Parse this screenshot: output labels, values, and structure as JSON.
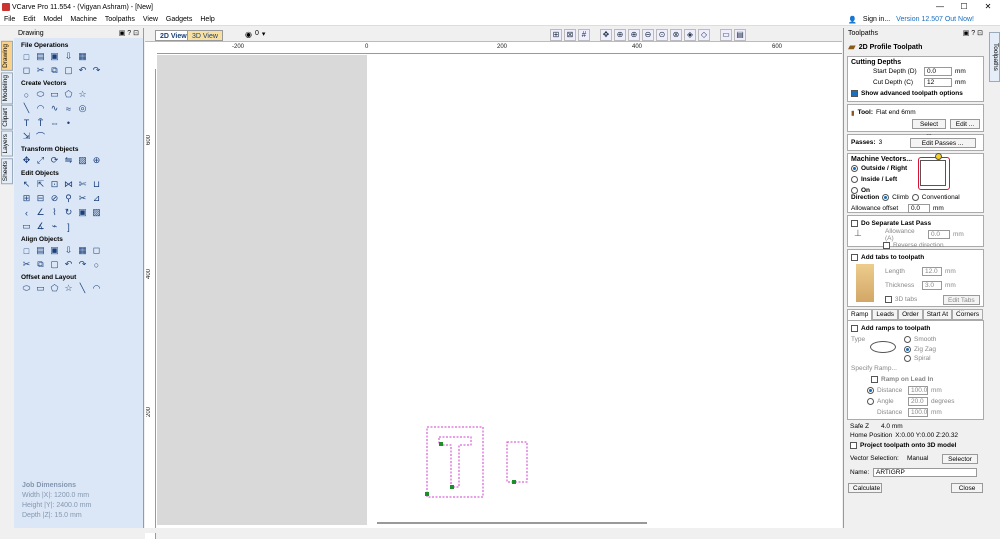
{
  "window": {
    "title": "VCarve Pro 11.554 - (Vigyan Ashram) - [New]",
    "min": "—",
    "max": "☐",
    "close": "✕"
  },
  "menu": {
    "items": [
      "File",
      "Edit",
      "Model",
      "Machine",
      "Toolpaths",
      "View",
      "Gadgets",
      "Help"
    ],
    "signin": "Sign in...",
    "version": "Version 12.507 Out Now!"
  },
  "left_panel": {
    "title": "Drawing",
    "side_tabs": [
      "Drawing",
      "Modeling",
      "Clipart",
      "Layers",
      "Sheets"
    ],
    "sections": [
      {
        "title": "File Operations",
        "rows": [
          [
            "new-file-icon",
            "open-file-icon",
            "save-icon",
            "import-icon",
            "folder-icon"
          ],
          [
            "select-all-icon",
            "cut-icon",
            "copy-icon",
            "paste-icon",
            "undo-icon",
            "redo-icon"
          ]
        ]
      },
      {
        "title": "Create Vectors",
        "rows": [
          [
            "circle-icon",
            "ellipse-icon",
            "rectangle-icon",
            "polygon-icon",
            "star-icon"
          ],
          [
            "line-icon",
            "arc-icon",
            "curve-icon",
            "wave-icon",
            "spiral-icon"
          ],
          [
            "text-icon",
            "text-on-curve-icon",
            "dimension-icon",
            "node-icon"
          ],
          [
            "offset-icon",
            "fillet-icon"
          ]
        ]
      },
      {
        "title": "Transform Objects",
        "rows": [
          [
            "move-icon",
            "scale-icon",
            "rotate-icon",
            "mirror-icon",
            "distort-icon",
            "align-center-icon"
          ]
        ]
      },
      {
        "title": "Edit Objects",
        "rows": [
          [
            "node-edit-icon",
            "select-icon",
            "transform-icon",
            "join-icon",
            "trim-icon",
            "weld-icon"
          ],
          [
            "group-icon",
            "ungroup-icon",
            "lock-icon",
            "break-icon",
            "scissors-icon",
            "measure-icon"
          ],
          [
            "chevron-icon",
            "arrow-icon",
            "smooth-icon",
            "convert-icon",
            "bitmap-icon",
            "image-icon"
          ],
          [
            "rect-select-icon",
            "angle-icon",
            "path-icon",
            "bracket-icon"
          ]
        ]
      },
      {
        "title": "Align Objects",
        "rows": [
          [
            "align-all-icon",
            "align-h-icon",
            "align-v-icon",
            "align-left-icon",
            "align-right-icon",
            "align-top-icon"
          ],
          [
            "align-mid-icon",
            "distribute-h-icon",
            "distribute-v-icon",
            "space-icon",
            "nest-icon",
            "anchor-icon"
          ]
        ]
      },
      {
        "title": "Offset and Layout",
        "rows": [
          [
            "offset-layout-icon",
            "array-icon",
            "circular-array-icon",
            "nodes-icon",
            "grid-copy-icon",
            "pattern-icon"
          ]
        ]
      }
    ],
    "job_dims": {
      "title": "Job Dimensions",
      "width": "Width  |X|: 1200.0 mm",
      "height": "Height |Y|: 2400.0 mm",
      "depth": "Depth  |Z|: 15.0 mm"
    }
  },
  "view": {
    "tab_2d": "2D View",
    "tab_3d": "3D View",
    "layer": "0"
  },
  "ruler_top": [
    "-200",
    "0",
    "200",
    "400",
    "600"
  ],
  "ruler_left": [
    "600",
    "400",
    "200"
  ],
  "right_panel": {
    "title": "Toolpaths",
    "toolpath_name": "2D Profile Toolpath",
    "cutting_depths": "Cutting Depths",
    "start_depth_label": "Start Depth (D)",
    "start_depth": "0.0",
    "unit_mm": "mm",
    "cut_depth_label": "Cut Depth (C)",
    "cut_depth": "12",
    "show_advanced": "Show advanced toolpath options",
    "tool_label": "Tool:",
    "tool_value": "Flat end 6mm",
    "select_btn": "Select ...",
    "edit_btn": "Edit ...",
    "passes_label": "Passes:",
    "passes_value": "3",
    "edit_passes_btn": "Edit Passes ...",
    "machine_vectors": "Machine Vectors...",
    "outside": "Outside / Right",
    "inside": "Inside / Left",
    "on": "On",
    "direction": "Direction",
    "climb": "Climb",
    "conventional": "Conventional",
    "allowance_label": "Allowance offset",
    "allowance_value": "0.0",
    "separate_last": "Do Separate Last Pass",
    "allowance_a": "Allowance (A)",
    "allowance_a_val": "0.0",
    "reverse_dir": "Reverse direction",
    "add_tabs": "Add tabs to toolpath",
    "length_label": "Length",
    "length_val": "12.0",
    "thickness_label": "Thickness",
    "thickness_val": "3.0",
    "tabs_3d": "3D tabs",
    "edit_tabs": "Edit Tabs ...",
    "tabs": [
      "Ramp",
      "Leads",
      "Order",
      "Start At",
      "Corners"
    ],
    "add_ramps": "Add ramps to toolpath",
    "type_label": "Type",
    "smooth": "Smooth",
    "zigzag": "Zig Zag",
    "spiral": "Spiral",
    "specify_ramp": "Specify Ramp...",
    "ramp_on_lead": "Ramp on Lead In",
    "distance": "Distance",
    "dist_val": "100.0",
    "angle": "Angle",
    "angle_val": "20.0",
    "degrees": "degrees",
    "distance2": "Distance",
    "dist2_val": "100.0",
    "safe_z_label": "Safe Z",
    "safe_z": "4.0 mm",
    "home_label": "Home Position",
    "home": "X:0.00 Y:0.00 Z:20.32",
    "project_3d": "Project toolpath onto 3D model",
    "vector_sel_label": "Vector Selection:",
    "vector_sel": "Manual",
    "selector_btn": "Selector ...",
    "name_label": "Name:",
    "name_value": "ARTIGRP",
    "calculate": "Calculate",
    "close": "Close"
  },
  "right_vtab": "Toolpaths"
}
